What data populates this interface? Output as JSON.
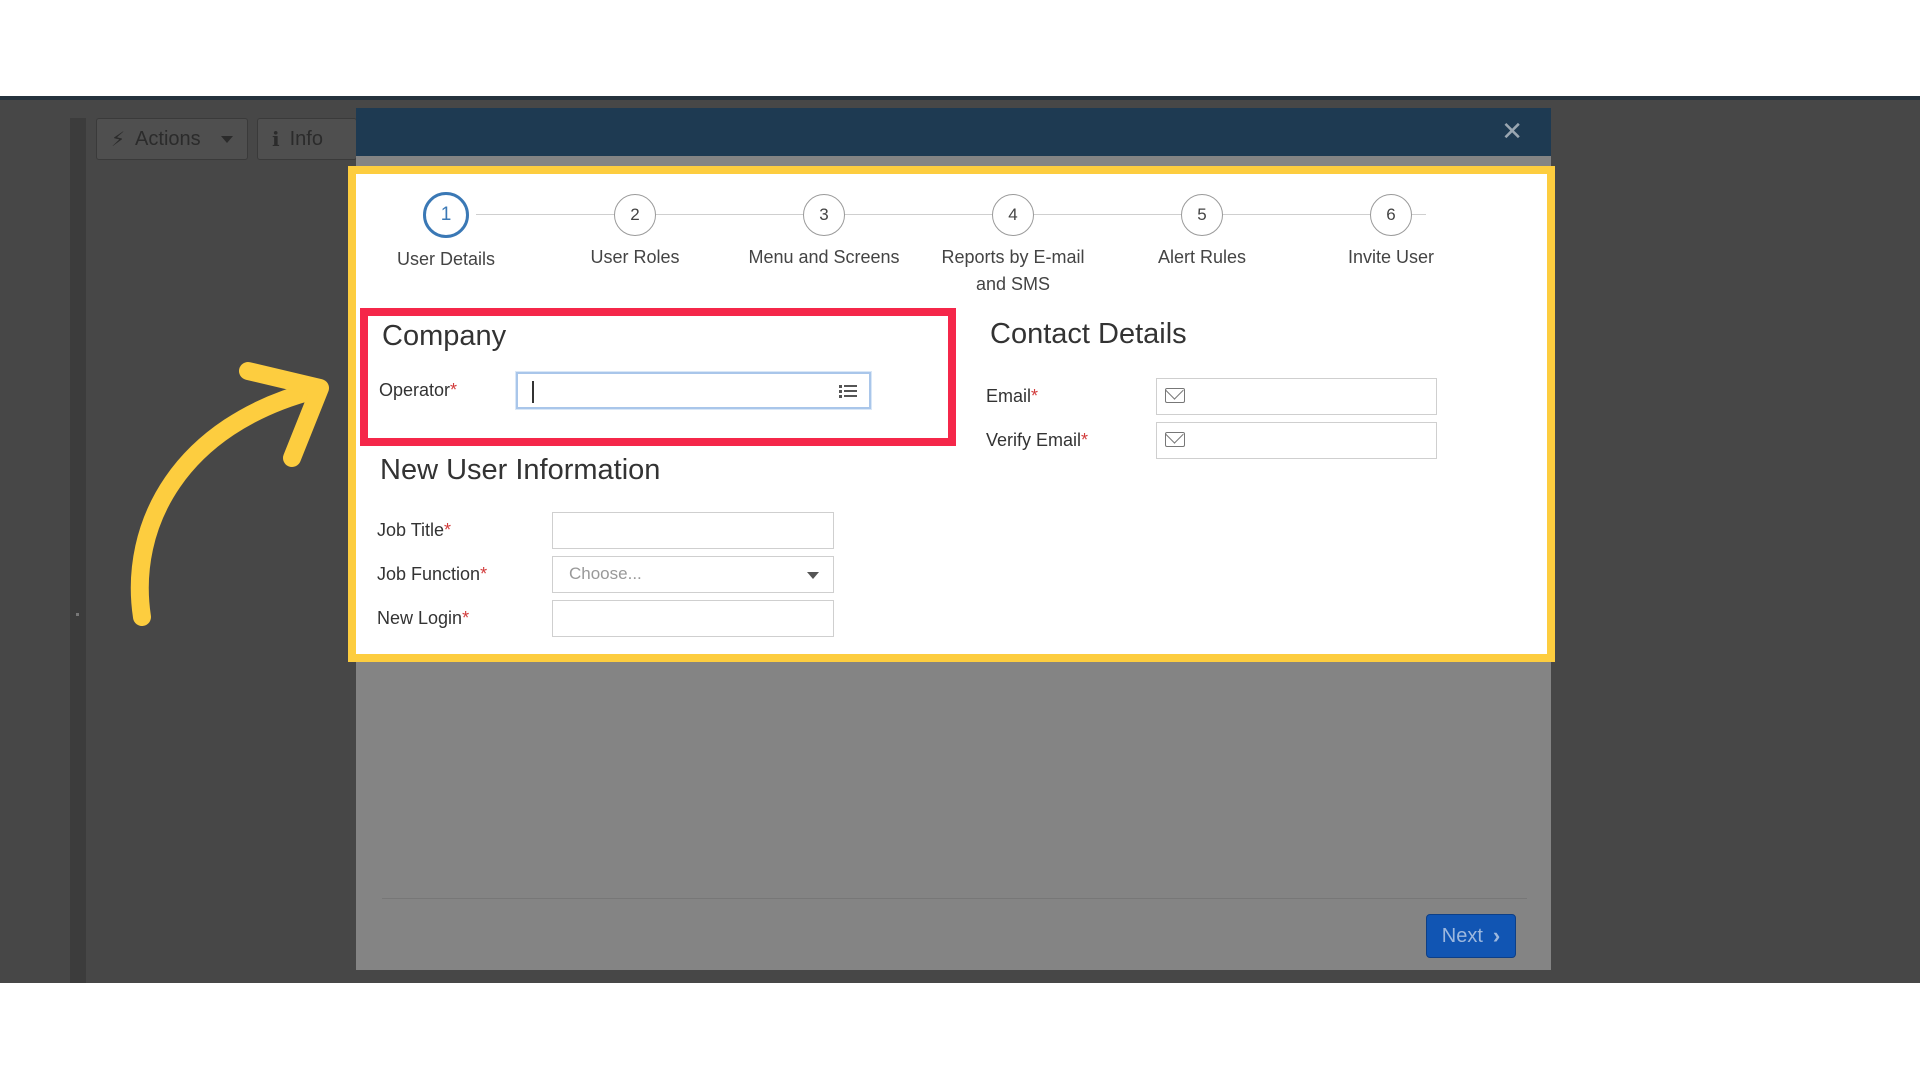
{
  "background": {
    "actions_label": "Actions",
    "info_label": "Info"
  },
  "modal": {
    "next_label": "Next"
  },
  "stepper": {
    "steps": [
      {
        "number": "1",
        "label": "User Details"
      },
      {
        "number": "2",
        "label": "User Roles"
      },
      {
        "number": "3",
        "label": "Menu and Screens"
      },
      {
        "number": "4",
        "label": "Reports by E-mail\nand SMS"
      },
      {
        "number": "5",
        "label": "Alert Rules"
      },
      {
        "number": "6",
        "label": "Invite User"
      }
    ],
    "active_step": 1
  },
  "company": {
    "title": "Company",
    "operator_label": "Operator",
    "required_mark": "*",
    "operator_value": ""
  },
  "contact": {
    "title": "Contact Details",
    "email_label": "Email",
    "verify_email_label": "Verify Email"
  },
  "new_user": {
    "title": "New User Information",
    "job_title_label": "Job Title",
    "job_function_label": "Job Function",
    "job_function_placeholder": "Choose...",
    "new_login_label": "New Login"
  },
  "colors": {
    "highlight_yellow": "#fdcd3f",
    "highlight_red": "#f5274a",
    "modal_header": "#1e3a52",
    "primary_button": "#1155b3",
    "active_step": "#3a78b5"
  }
}
